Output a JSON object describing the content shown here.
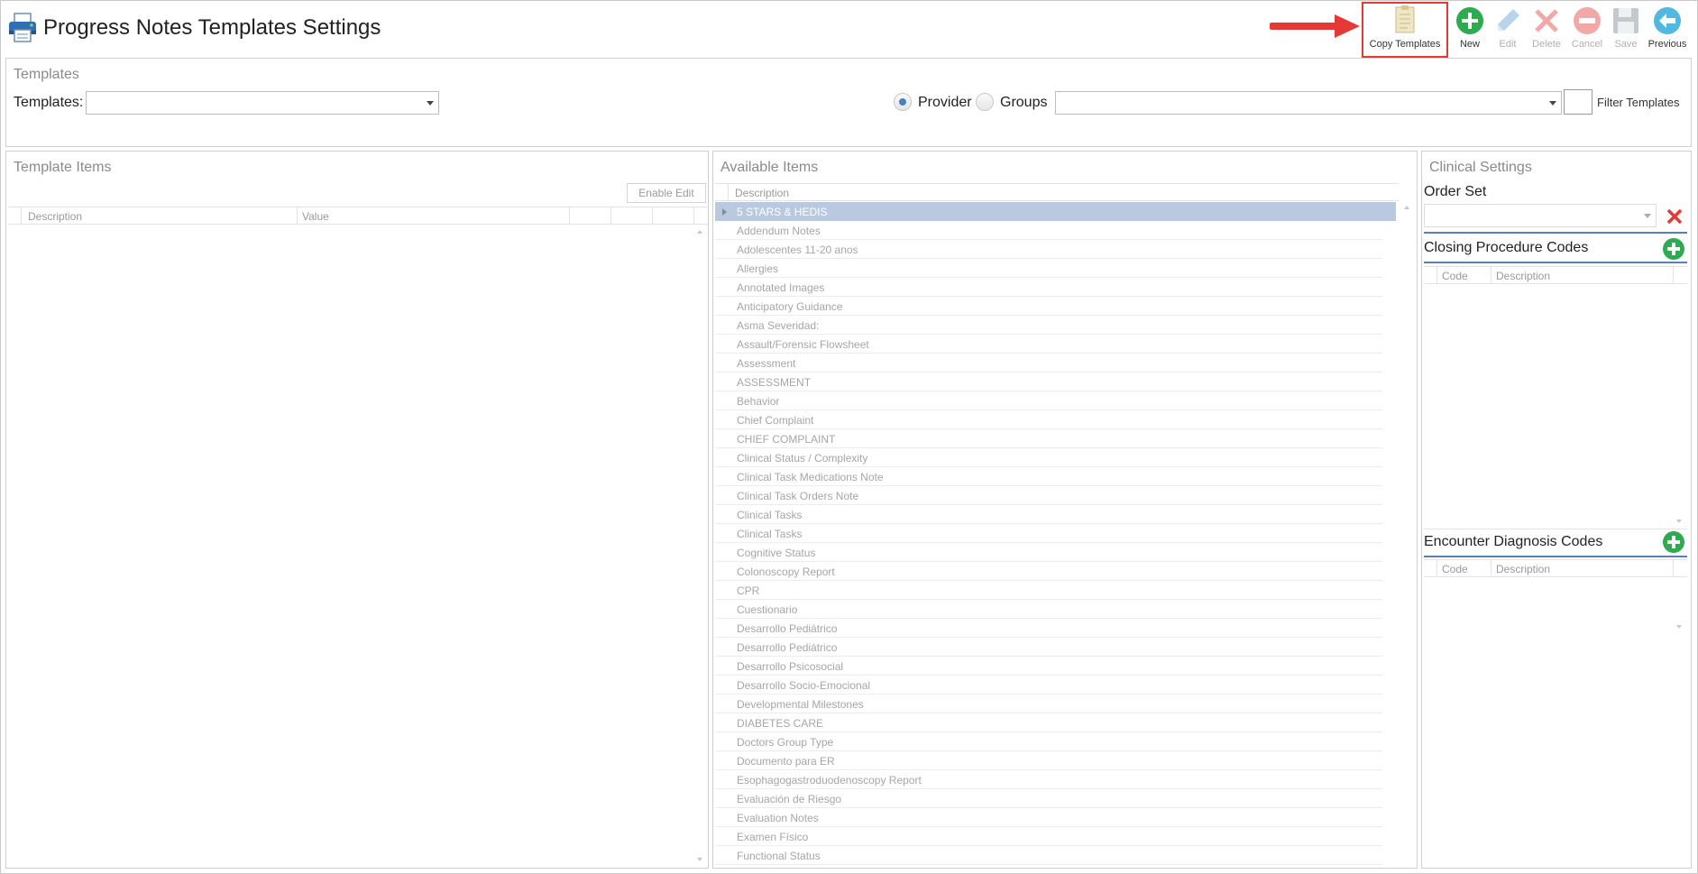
{
  "header": {
    "title": "Progress Notes Templates Settings"
  },
  "toolbar": {
    "buttons": [
      {
        "id": "copy",
        "label": "Copy Templates",
        "icon": "copy-templates-icon",
        "enabled": true
      },
      {
        "id": "new",
        "label": "New",
        "icon": "plus-circle-icon",
        "enabled": true
      },
      {
        "id": "edit",
        "label": "Edit",
        "icon": "pencil-icon",
        "enabled": false
      },
      {
        "id": "delete",
        "label": "Delete",
        "icon": "x-icon",
        "enabled": false
      },
      {
        "id": "cancel",
        "label": "Cancel",
        "icon": "minus-circle-icon",
        "enabled": false
      },
      {
        "id": "save",
        "label": "Save",
        "icon": "floppy-disk-icon",
        "enabled": false
      },
      {
        "id": "previous",
        "label": "Previous",
        "icon": "arrow-left-circle-icon",
        "enabled": true
      }
    ]
  },
  "templates_panel": {
    "title": "Templates",
    "templates_label": "Templates:",
    "templates_value": "",
    "provider_label": "Provider",
    "groups_label": "Groups",
    "selected_filter": "Provider",
    "groups_value": "",
    "filter_label": "Filter Templates"
  },
  "template_items": {
    "title": "Template Items",
    "enable_edit_label": "Enable Edit",
    "columns": [
      "Description",
      "Value"
    ]
  },
  "available_items": {
    "title": "Available Items",
    "column": "Description",
    "items": [
      "5 STARS & HEDIS",
      "Addendum Notes",
      "Adolescentes 11-20 anos",
      "Allergies",
      "Annotated Images",
      "Anticipatory Guidance",
      "Asma Severidad:",
      "Assault/Forensic Flowsheet",
      "Assessment",
      "ASSESSMENT",
      "Behavior",
      "Chief Complaint",
      "CHIEF COMPLAINT",
      "Clinical Status / Complexity",
      "Clinical Task Medications Note",
      "Clinical Task Orders Note",
      "Clinical Tasks",
      "Clinical Tasks",
      "Cognitive Status",
      "Colonoscopy Report",
      "CPR",
      "Cuestionario",
      "Desarrollo Pediátrico",
      "Desarrollo Pediátrico",
      "Desarrollo Psicosocial",
      "Desarrollo Socio-Emocional",
      "Developmental Milestones",
      "DIABETES CARE",
      "Doctors Group Type",
      "Documento para ER",
      "Esophagogastroduodenoscopy Report",
      "Evaluación de Riesgo",
      "Evaluation Notes",
      "Examen Físico",
      "Functional Status"
    ],
    "selected_index": 0
  },
  "clinical_settings": {
    "title": "Clinical Settings",
    "order_set_label": "Order Set",
    "order_set_value": "",
    "closing_title": "Closing Procedure Codes",
    "encounter_title": "Encounter Diagnosis Codes",
    "code_col": "Code",
    "desc_col": "Description"
  },
  "colors": {
    "accent_blue": "#4a7fc1",
    "green": "#2eaa4f",
    "red_highlight": "#e53935",
    "selected_row": "#b9c9df"
  }
}
